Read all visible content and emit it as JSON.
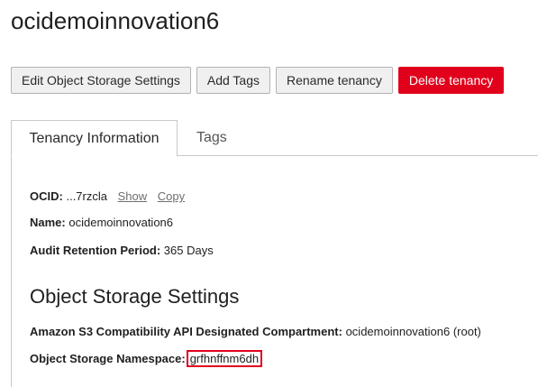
{
  "header": {
    "title": "ocidemoinnovation6"
  },
  "toolbar": {
    "edit_label": "Edit Object Storage Settings",
    "add_tags_label": "Add Tags",
    "rename_label": "Rename tenancy",
    "delete_label": "Delete tenancy",
    "delete_color": "#e0001b"
  },
  "tabs": [
    {
      "label": "Tenancy Information",
      "active": true
    },
    {
      "label": "Tags",
      "active": false
    }
  ],
  "tenancy_info": {
    "ocid_label": "OCID:",
    "ocid_value": "...7rzcla",
    "show_link": "Show",
    "copy_link": "Copy",
    "name_label": "Name:",
    "name_value": "ocidemoinnovation6",
    "audit_label": "Audit Retention Period:",
    "audit_value": "365 Days"
  },
  "object_storage": {
    "section_title": "Object Storage Settings",
    "s3_label": "Amazon S3 Compatibility API Designated Compartment:",
    "s3_value": "ocidemoinnovation6 (root)",
    "namespace_label": "Object Storage Namespace:",
    "namespace_value": "grfhnffnm6dh",
    "highlight_color": "#e3001b"
  }
}
